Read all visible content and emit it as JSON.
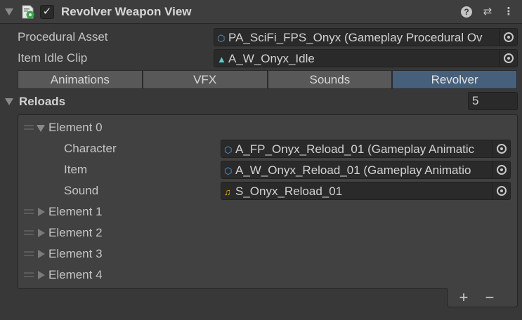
{
  "header": {
    "title": "Revolver Weapon View",
    "enabled_mark": "✓",
    "help_icon": "?",
    "settings_icon": "⇄",
    "menu_icon": "⋮"
  },
  "properties": {
    "procedural_asset": {
      "label": "Procedural Asset",
      "value": "PA_SciFi_FPS_Onyx (Gameplay Procedural Ov",
      "icon": "asset-cube-icon"
    },
    "item_idle_clip": {
      "label": "Item Idle Clip",
      "value": "A_W_Onyx_Idle",
      "icon": "animation-clip-icon"
    }
  },
  "tabs": [
    {
      "label": "Animations",
      "active": false
    },
    {
      "label": "VFX",
      "active": false
    },
    {
      "label": "Sounds",
      "active": false
    },
    {
      "label": "Revolver",
      "active": true
    }
  ],
  "reloads": {
    "label": "Reloads",
    "size": "5",
    "elements": [
      {
        "label": "Element 0",
        "expanded": true,
        "fields": [
          {
            "label": "Character",
            "value": "A_FP_Onyx_Reload_01 (Gameplay Animatic",
            "icon": "asset-cube-icon"
          },
          {
            "label": "Item",
            "value": "A_W_Onyx_Reload_01 (Gameplay Animatio",
            "icon": "asset-cube-icon"
          },
          {
            "label": "Sound",
            "value": "S_Onyx_Reload_01",
            "icon": "audio-clip-icon"
          }
        ]
      },
      {
        "label": "Element 1",
        "expanded": false
      },
      {
        "label": "Element 2",
        "expanded": false
      },
      {
        "label": "Element 3",
        "expanded": false
      },
      {
        "label": "Element 4",
        "expanded": false
      }
    ],
    "add_label": "+",
    "remove_label": "−"
  },
  "colors": {
    "background": "#383838",
    "field": "#2a2a2a",
    "tab": "#585858",
    "tab_active": "#46607c",
    "asset_icon": "#5aa0d8",
    "clip_icon": "#5ed0c8",
    "audio_icon": "#e8b020"
  }
}
